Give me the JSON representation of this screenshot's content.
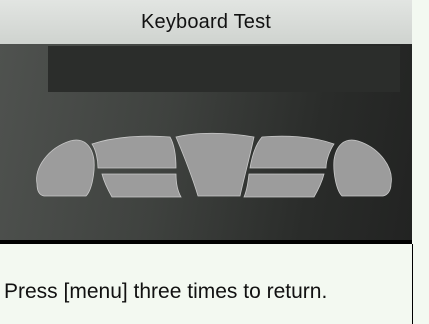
{
  "window": {
    "title": "Keyboard Test"
  },
  "panel": {
    "keys": [
      {
        "name": "left-key",
        "icon": "left-key-shape"
      },
      {
        "name": "left-upper-key",
        "icon": "upper-left-bar"
      },
      {
        "name": "left-lower-key",
        "icon": "lower-left-bar"
      },
      {
        "name": "center-key",
        "icon": "center-trapezoid"
      },
      {
        "name": "right-upper-key",
        "icon": "upper-right-bar"
      },
      {
        "name": "right-lower-key",
        "icon": "lower-right-bar"
      },
      {
        "name": "right-key",
        "icon": "right-key-shape"
      }
    ]
  },
  "status": {
    "message": "Press [menu] three times to return."
  },
  "colors": {
    "title_bar": "#d9dcd9",
    "panel_dark": "#2a2c2a",
    "key_fill": "#9c9c9c",
    "background": "#f3f9f1"
  }
}
